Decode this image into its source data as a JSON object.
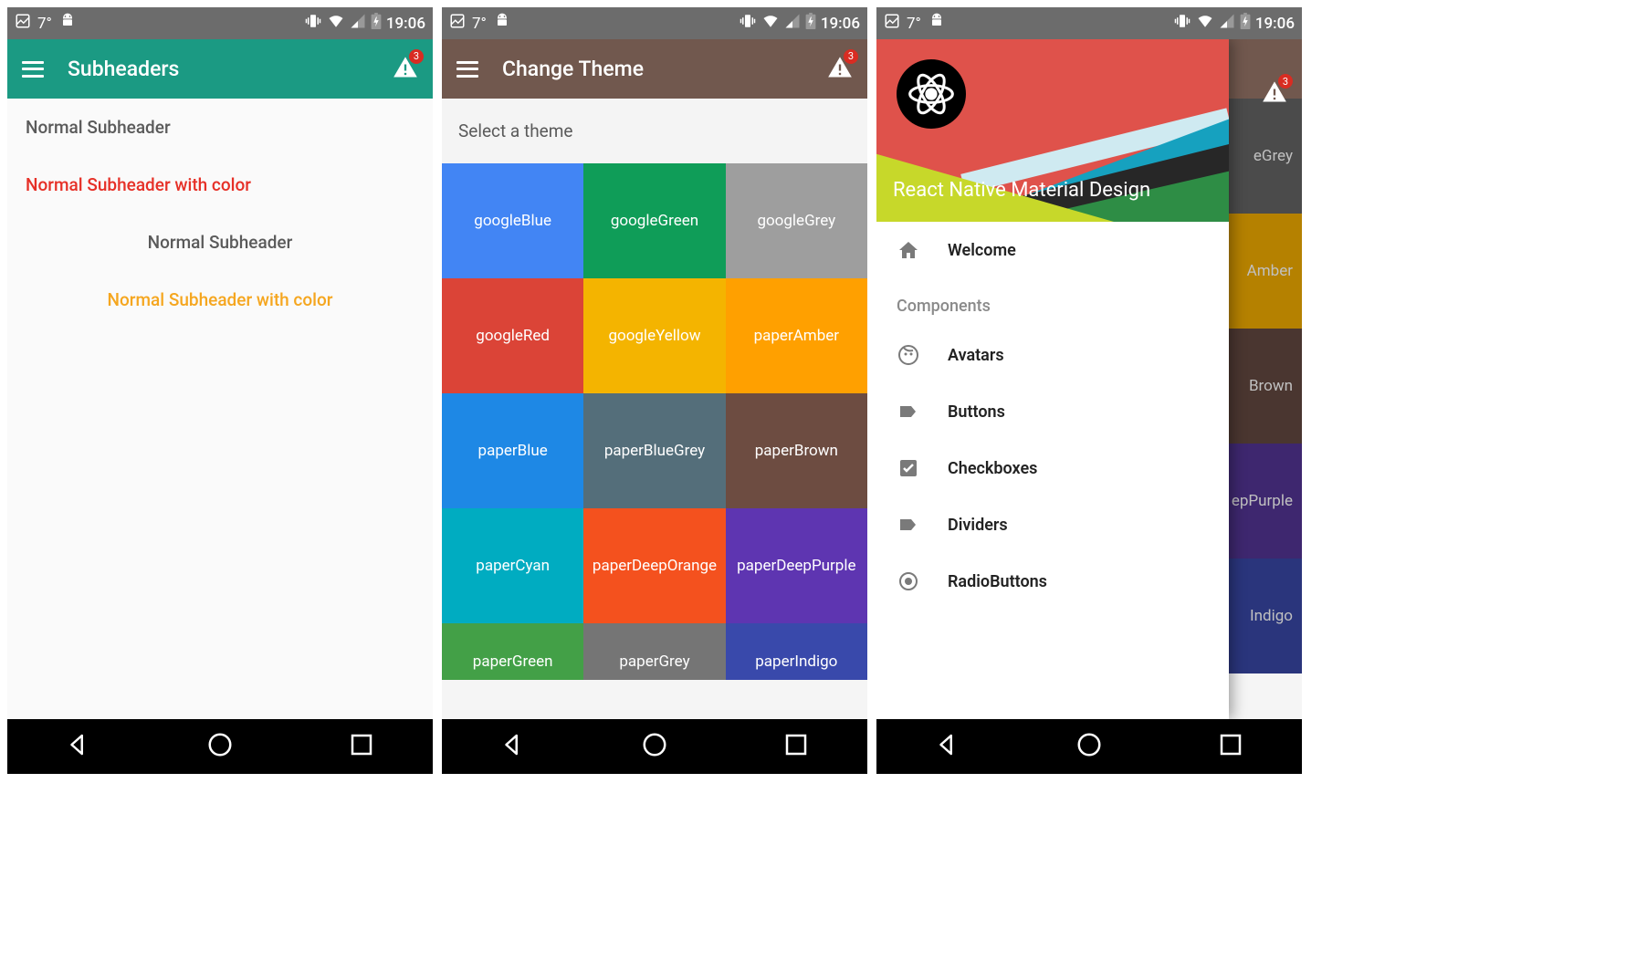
{
  "statusbar": {
    "temperature": "7°",
    "time": "19:06"
  },
  "screen1": {
    "appbar_title": "Subheaders",
    "badge_count": "3",
    "items": [
      {
        "text": "Normal Subheader",
        "cls": "sub-normal"
      },
      {
        "text": "Normal Subheader with color",
        "cls": "sub-red"
      },
      {
        "text": "Normal Subheader",
        "cls": "sub-grey"
      },
      {
        "text": "Normal Subheader with color",
        "cls": "sub-orange"
      }
    ]
  },
  "screen2": {
    "appbar_title": "Change Theme",
    "badge_count": "3",
    "select_label": "Select a theme",
    "themes": [
      {
        "name": "googleBlue",
        "color": "#4285f4"
      },
      {
        "name": "googleGreen",
        "color": "#0f9d58"
      },
      {
        "name": "googleGrey",
        "color": "#9e9e9e"
      },
      {
        "name": "googleRed",
        "color": "#db4437"
      },
      {
        "name": "googleYellow",
        "color": "#f4b400"
      },
      {
        "name": "paperAmber",
        "color": "#ffa000"
      },
      {
        "name": "paperBlue",
        "color": "#1e88e5"
      },
      {
        "name": "paperBlueGrey",
        "color": "#546e7a"
      },
      {
        "name": "paperBrown",
        "color": "#6d4c41"
      },
      {
        "name": "paperCyan",
        "color": "#00acc1"
      },
      {
        "name": "paperDeepOrange",
        "color": "#f4511e"
      },
      {
        "name": "paperDeepPurple",
        "color": "#5e35b1"
      },
      {
        "name": "paperGreen",
        "color": "#43a047"
      },
      {
        "name": "paperGrey",
        "color": "#757575"
      },
      {
        "name": "paperIndigo",
        "color": "#3949ab"
      }
    ]
  },
  "screen3": {
    "badge_count": "3",
    "drawer_title": "React Native Material Design",
    "bg_rows": [
      {
        "label": "eGrey",
        "color": "#4b4b4b"
      },
      {
        "label": "Amber",
        "color": "#b58100"
      },
      {
        "label": "Brown",
        "color": "#4a3630"
      },
      {
        "label": "epPurple",
        "color": "#3e276f"
      },
      {
        "label": "Indigo",
        "color": "#2a357c"
      }
    ],
    "items": [
      {
        "icon": "home",
        "label": "Welcome"
      }
    ],
    "components_label": "Components",
    "component_items": [
      {
        "icon": "face",
        "label": "Avatars"
      },
      {
        "icon": "label",
        "label": "Buttons"
      },
      {
        "icon": "check",
        "label": "Checkboxes"
      },
      {
        "icon": "label",
        "label": "Dividers"
      },
      {
        "icon": "radio",
        "label": "RadioButtons"
      }
    ]
  }
}
